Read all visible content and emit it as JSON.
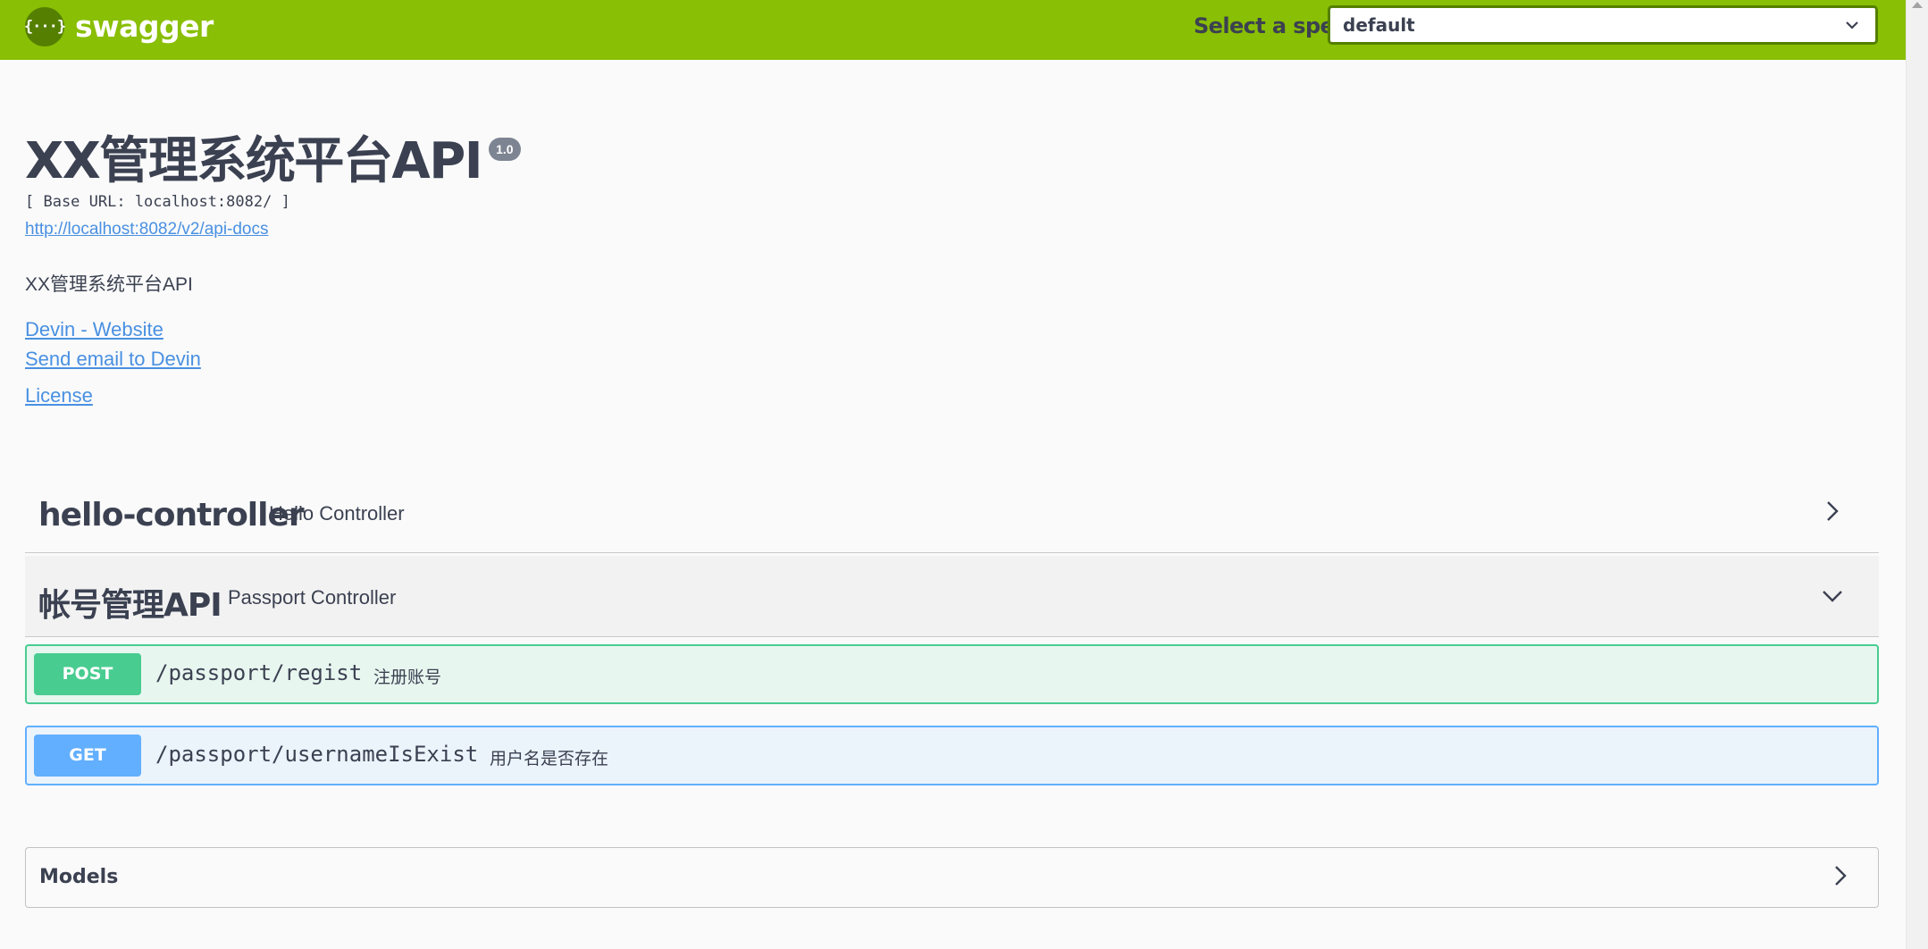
{
  "topbar": {
    "logo_glyph": "{···}",
    "logo_text": "swagger",
    "spec_label": "Select a spec",
    "spec_value": "default",
    "background": "#89bf04"
  },
  "info": {
    "title": "XX管理系统平台API",
    "version": "1.0",
    "base_url": "[ Base URL: localhost:8082/ ]",
    "api_docs_link": "http://localhost:8082/v2/api-docs",
    "description": "XX管理系统平台API",
    "contact_website": "Devin - Website",
    "contact_email": "Send email to Devin",
    "license": "License"
  },
  "tags": [
    {
      "name": "hello-controller",
      "description": "Hello Controller",
      "expanded": false,
      "arrow_icon": "chevron-right-icon"
    },
    {
      "name": "帐号管理API",
      "description": "Passport Controller",
      "expanded": true,
      "arrow_icon": "chevron-down-icon"
    }
  ],
  "operations": [
    {
      "method": "POST",
      "path": "/passport/regist",
      "summary": "注册账号",
      "color": "#49cc90"
    },
    {
      "method": "GET",
      "path": "/passport/usernameIsExist",
      "summary": "用户名是否存在",
      "color": "#61affe"
    }
  ],
  "models": {
    "title": "Models",
    "arrow_icon": "chevron-right-icon"
  }
}
